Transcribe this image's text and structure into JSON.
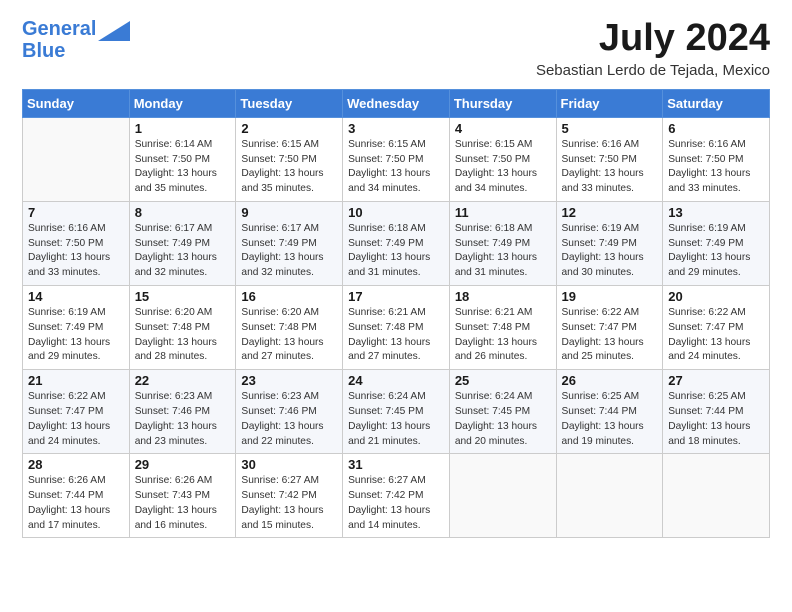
{
  "header": {
    "logo_line1": "General",
    "logo_line2": "Blue",
    "month_title": "July 2024",
    "subtitle": "Sebastian Lerdo de Tejada, Mexico"
  },
  "days_of_week": [
    "Sunday",
    "Monday",
    "Tuesday",
    "Wednesday",
    "Thursday",
    "Friday",
    "Saturday"
  ],
  "weeks": [
    [
      {
        "day": "",
        "info": ""
      },
      {
        "day": "1",
        "info": "Sunrise: 6:14 AM\nSunset: 7:50 PM\nDaylight: 13 hours\nand 35 minutes."
      },
      {
        "day": "2",
        "info": "Sunrise: 6:15 AM\nSunset: 7:50 PM\nDaylight: 13 hours\nand 35 minutes."
      },
      {
        "day": "3",
        "info": "Sunrise: 6:15 AM\nSunset: 7:50 PM\nDaylight: 13 hours\nand 34 minutes."
      },
      {
        "day": "4",
        "info": "Sunrise: 6:15 AM\nSunset: 7:50 PM\nDaylight: 13 hours\nand 34 minutes."
      },
      {
        "day": "5",
        "info": "Sunrise: 6:16 AM\nSunset: 7:50 PM\nDaylight: 13 hours\nand 33 minutes."
      },
      {
        "day": "6",
        "info": "Sunrise: 6:16 AM\nSunset: 7:50 PM\nDaylight: 13 hours\nand 33 minutes."
      }
    ],
    [
      {
        "day": "7",
        "info": "Sunrise: 6:16 AM\nSunset: 7:50 PM\nDaylight: 13 hours\nand 33 minutes."
      },
      {
        "day": "8",
        "info": "Sunrise: 6:17 AM\nSunset: 7:49 PM\nDaylight: 13 hours\nand 32 minutes."
      },
      {
        "day": "9",
        "info": "Sunrise: 6:17 AM\nSunset: 7:49 PM\nDaylight: 13 hours\nand 32 minutes."
      },
      {
        "day": "10",
        "info": "Sunrise: 6:18 AM\nSunset: 7:49 PM\nDaylight: 13 hours\nand 31 minutes."
      },
      {
        "day": "11",
        "info": "Sunrise: 6:18 AM\nSunset: 7:49 PM\nDaylight: 13 hours\nand 31 minutes."
      },
      {
        "day": "12",
        "info": "Sunrise: 6:19 AM\nSunset: 7:49 PM\nDaylight: 13 hours\nand 30 minutes."
      },
      {
        "day": "13",
        "info": "Sunrise: 6:19 AM\nSunset: 7:49 PM\nDaylight: 13 hours\nand 29 minutes."
      }
    ],
    [
      {
        "day": "14",
        "info": "Sunrise: 6:19 AM\nSunset: 7:49 PM\nDaylight: 13 hours\nand 29 minutes."
      },
      {
        "day": "15",
        "info": "Sunrise: 6:20 AM\nSunset: 7:48 PM\nDaylight: 13 hours\nand 28 minutes."
      },
      {
        "day": "16",
        "info": "Sunrise: 6:20 AM\nSunset: 7:48 PM\nDaylight: 13 hours\nand 27 minutes."
      },
      {
        "day": "17",
        "info": "Sunrise: 6:21 AM\nSunset: 7:48 PM\nDaylight: 13 hours\nand 27 minutes."
      },
      {
        "day": "18",
        "info": "Sunrise: 6:21 AM\nSunset: 7:48 PM\nDaylight: 13 hours\nand 26 minutes."
      },
      {
        "day": "19",
        "info": "Sunrise: 6:22 AM\nSunset: 7:47 PM\nDaylight: 13 hours\nand 25 minutes."
      },
      {
        "day": "20",
        "info": "Sunrise: 6:22 AM\nSunset: 7:47 PM\nDaylight: 13 hours\nand 24 minutes."
      }
    ],
    [
      {
        "day": "21",
        "info": "Sunrise: 6:22 AM\nSunset: 7:47 PM\nDaylight: 13 hours\nand 24 minutes."
      },
      {
        "day": "22",
        "info": "Sunrise: 6:23 AM\nSunset: 7:46 PM\nDaylight: 13 hours\nand 23 minutes."
      },
      {
        "day": "23",
        "info": "Sunrise: 6:23 AM\nSunset: 7:46 PM\nDaylight: 13 hours\nand 22 minutes."
      },
      {
        "day": "24",
        "info": "Sunrise: 6:24 AM\nSunset: 7:45 PM\nDaylight: 13 hours\nand 21 minutes."
      },
      {
        "day": "25",
        "info": "Sunrise: 6:24 AM\nSunset: 7:45 PM\nDaylight: 13 hours\nand 20 minutes."
      },
      {
        "day": "26",
        "info": "Sunrise: 6:25 AM\nSunset: 7:44 PM\nDaylight: 13 hours\nand 19 minutes."
      },
      {
        "day": "27",
        "info": "Sunrise: 6:25 AM\nSunset: 7:44 PM\nDaylight: 13 hours\nand 18 minutes."
      }
    ],
    [
      {
        "day": "28",
        "info": "Sunrise: 6:26 AM\nSunset: 7:44 PM\nDaylight: 13 hours\nand 17 minutes."
      },
      {
        "day": "29",
        "info": "Sunrise: 6:26 AM\nSunset: 7:43 PM\nDaylight: 13 hours\nand 16 minutes."
      },
      {
        "day": "30",
        "info": "Sunrise: 6:27 AM\nSunset: 7:42 PM\nDaylight: 13 hours\nand 15 minutes."
      },
      {
        "day": "31",
        "info": "Sunrise: 6:27 AM\nSunset: 7:42 PM\nDaylight: 13 hours\nand 14 minutes."
      },
      {
        "day": "",
        "info": ""
      },
      {
        "day": "",
        "info": ""
      },
      {
        "day": "",
        "info": ""
      }
    ]
  ]
}
